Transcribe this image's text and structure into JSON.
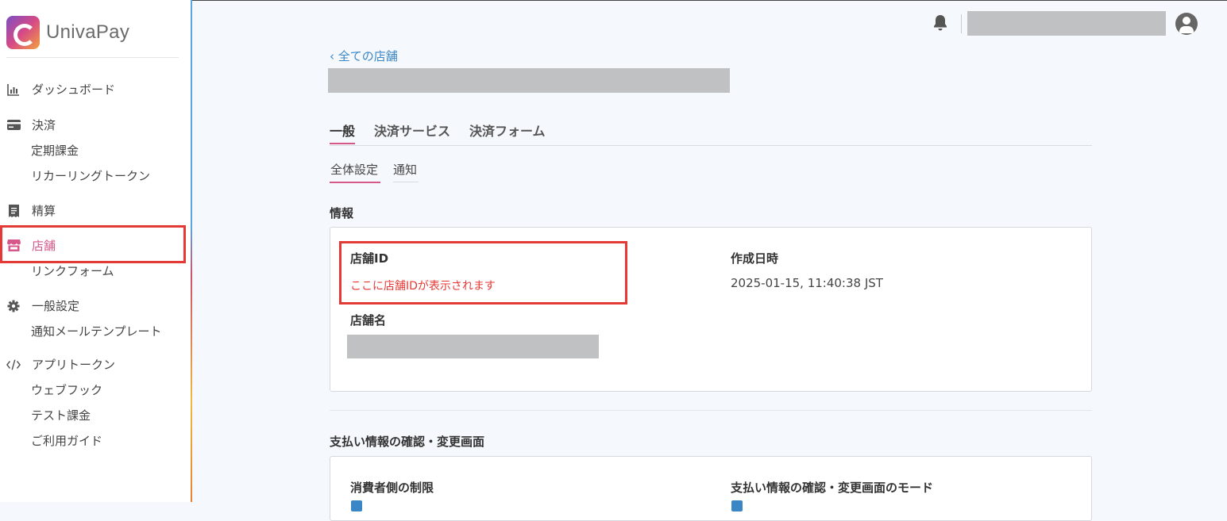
{
  "app": {
    "name": "UnivaPay"
  },
  "sidebar": {
    "items": [
      {
        "label": "ダッシュボード",
        "icon": "chart-icon"
      },
      {
        "label": "決済",
        "icon": "credit-card-icon",
        "children": [
          "定期課金",
          "リカーリングトークン"
        ]
      },
      {
        "label": "精算",
        "icon": "receipt-icon"
      },
      {
        "label": "店舗",
        "icon": "store-icon",
        "active": true,
        "children": [
          "リンクフォーム"
        ]
      },
      {
        "label": "一般設定",
        "icon": "gear-icon",
        "children": [
          "通知メールテンプレート"
        ]
      },
      {
        "label": "アプリトークン",
        "icon": "code-icon",
        "children": [
          "ウェブフック",
          "テスト課金",
          "ご利用ガイド"
        ]
      }
    ]
  },
  "breadcrumb": {
    "back_label": "‹ 全ての店舗"
  },
  "tabs": [
    "一般",
    "決済サービス",
    "決済フォーム"
  ],
  "subtabs": [
    "全体設定",
    "通知"
  ],
  "info_section": {
    "title": "情報",
    "store_id_label": "店舗ID",
    "store_id_value": "ここに店舗IDが表示されます",
    "created_label": "作成日時",
    "created_value": "2025-01-15, 11:40:38 JST",
    "store_name_label": "店舗名"
  },
  "payment_section": {
    "title": "支払い情報の確認・変更画面",
    "left_label": "消費者側の制限",
    "right_label": "支払い情報の確認・変更画面のモード"
  },
  "colors": {
    "accent": "#d6578a",
    "link": "#3b86c6",
    "highlight": "#e53935"
  }
}
